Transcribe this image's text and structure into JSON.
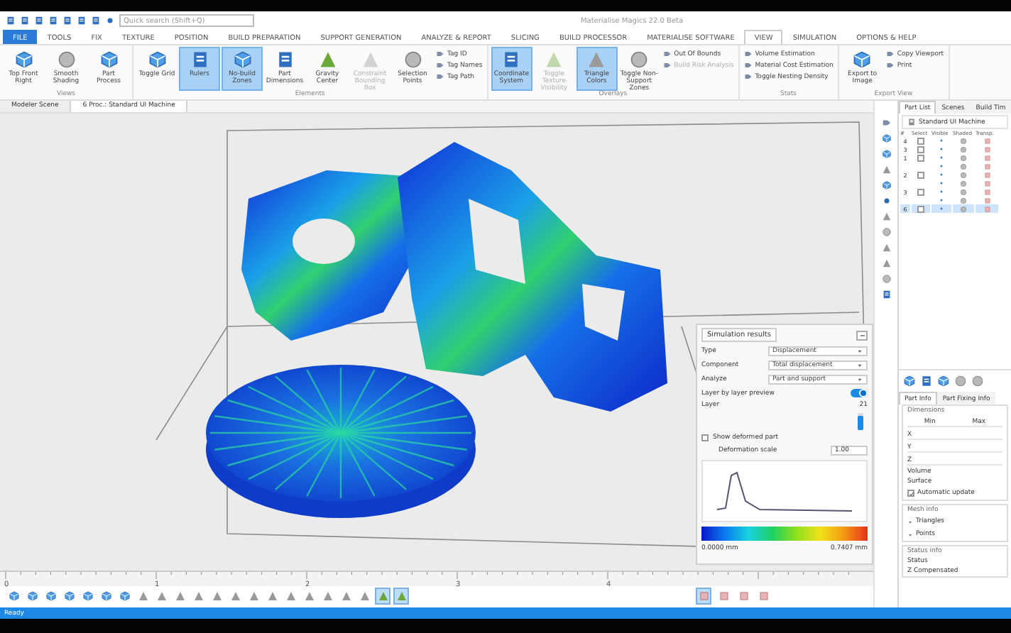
{
  "window": {
    "title": "Materialise Magics 22.0 Beta"
  },
  "quick_access": {
    "search": {
      "placeholder": "Quick search (Shift+Q)"
    }
  },
  "ribbon_tabs": [
    {
      "label": "FILE",
      "kind": "file",
      "selected": false
    },
    {
      "label": "TOOLS",
      "kind": "tab",
      "selected": false
    },
    {
      "label": "FIX",
      "kind": "tab",
      "selected": false
    },
    {
      "label": "TEXTURE",
      "kind": "tab",
      "selected": false
    },
    {
      "label": "POSITION",
      "kind": "tab",
      "selected": false
    },
    {
      "label": "BUILD PREPARATION",
      "kind": "tab",
      "selected": false
    },
    {
      "label": "SUPPORT GENERATION",
      "kind": "tab",
      "selected": false
    },
    {
      "label": "ANALYZE & REPORT",
      "kind": "tab",
      "selected": false
    },
    {
      "label": "SLICING",
      "kind": "tab",
      "selected": false
    },
    {
      "label": "BUILD PROCESSOR",
      "kind": "tab",
      "selected": false
    },
    {
      "label": "MATERIALISE SOFTWARE",
      "kind": "tab",
      "selected": false
    },
    {
      "label": "VIEW",
      "kind": "tab",
      "selected": true
    },
    {
      "label": "SIMULATION",
      "kind": "tab",
      "selected": false
    },
    {
      "label": "OPTIONS & HELP",
      "kind": "tab",
      "selected": false
    }
  ],
  "ribbon_groups": [
    {
      "title": "Views",
      "items": [
        {
          "kind": "large",
          "label": "Top Front Right",
          "selected": false,
          "disabled": false
        },
        {
          "kind": "large",
          "label": "Smooth Shading",
          "selected": false,
          "disabled": false
        },
        {
          "kind": "large",
          "label": "Part Process",
          "selected": false,
          "disabled": false
        }
      ]
    },
    {
      "title": "Elements",
      "items": [
        {
          "kind": "large",
          "label": "Toggle Grid",
          "selected": false,
          "disabled": false
        },
        {
          "kind": "large",
          "label": "Rulers",
          "selected": true,
          "disabled": false
        },
        {
          "kind": "large",
          "label": "No-build Zones",
          "selected": true,
          "disabled": false
        },
        {
          "kind": "large",
          "label": "Part Dimensions",
          "selected": false,
          "disabled": false
        },
        {
          "kind": "large",
          "label": "Gravity Center",
          "selected": false,
          "disabled": false
        },
        {
          "kind": "large",
          "label": "Constraint Bounding Box",
          "selected": false,
          "disabled": true
        },
        {
          "kind": "large",
          "label": "Selection Points",
          "selected": false,
          "disabled": false
        },
        {
          "kind": "stack",
          "entries": [
            {
              "label": "Tag ID",
              "disabled": false
            },
            {
              "label": "Tag Names",
              "disabled": false
            },
            {
              "label": "Tag Path",
              "disabled": false
            }
          ]
        }
      ]
    },
    {
      "title": "Overlays",
      "items": [
        {
          "kind": "large",
          "label": "Coordinate System",
          "selected": true,
          "disabled": false
        },
        {
          "kind": "large",
          "label": "Toggle Texture Visibility",
          "selected": false,
          "disabled": true
        },
        {
          "kind": "large",
          "label": "Triangle Colors",
          "selected": true,
          "disabled": false
        },
        {
          "kind": "large",
          "label": "Toggle Non-Support Zones",
          "selected": false,
          "disabled": false
        },
        {
          "kind": "stack",
          "entries": [
            {
              "label": "Out Of Bounds",
              "disabled": false
            },
            {
              "label": "Build Risk Analysis",
              "disabled": true
            }
          ]
        }
      ]
    },
    {
      "title": "Stats",
      "items": [
        {
          "kind": "stack",
          "entries": [
            {
              "label": "Volume Estimation",
              "disabled": false
            },
            {
              "label": "Material Cost Estimation",
              "disabled": false
            },
            {
              "label": "Toggle Nesting Density",
              "disabled": false
            }
          ]
        }
      ]
    },
    {
      "title": "Export View",
      "items": [
        {
          "kind": "large",
          "label": "Export to Image",
          "selected": false,
          "disabled": false
        },
        {
          "kind": "stack",
          "entries": [
            {
              "label": "Copy Viewport",
              "disabled": false
            },
            {
              "label": "Print",
              "disabled": false
            }
          ]
        }
      ]
    }
  ],
  "document_tabs": [
    {
      "label": "Modeler Scene",
      "selected": false
    },
    {
      "label": "6 Proc.: Standard UI Machine",
      "selected": true
    }
  ],
  "simulation_panel": {
    "title": "Simulation results",
    "fields": [
      {
        "label": "Type",
        "value": "Displacement"
      },
      {
        "label": "Component",
        "value": "Total displacement"
      },
      {
        "label": "Analyze",
        "value": "Part and support"
      }
    ],
    "layer_preview": {
      "label": "Layer by layer preview",
      "on": true
    },
    "layer": {
      "label": "Layer",
      "value": "21",
      "level": 0.85
    },
    "show_deformed": {
      "label": "Show deformed part",
      "checked": false
    },
    "deformation_scale": {
      "label": "Deformation scale",
      "value": "1.00"
    },
    "scale_min": "0.0000 mm",
    "scale_max": "0.7407 mm"
  },
  "ruler": {
    "labels": [
      "0",
      "1",
      "2",
      "3",
      "4"
    ]
  },
  "bottom_toolbar": [
    {
      "selected": false
    },
    {
      "selected": false
    },
    {
      "selected": false
    },
    {
      "selected": false
    },
    {
      "selected": false
    },
    {
      "selected": false
    },
    {
      "selected": false
    },
    {
      "selected": false
    },
    {
      "selected": false
    },
    {
      "selected": false
    },
    {
      "selected": false
    },
    {
      "selected": false
    },
    {
      "selected": false
    },
    {
      "selected": false
    },
    {
      "selected": false
    },
    {
      "selected": false
    },
    {
      "selected": false
    },
    {
      "selected": false
    },
    {
      "selected": false
    },
    {
      "selected": false
    },
    {
      "selected": true
    },
    {
      "selected": true
    }
  ],
  "view_buttons": [
    {
      "selected": true
    },
    {
      "selected": false
    },
    {
      "selected": false
    },
    {
      "selected": false
    }
  ],
  "part_list": {
    "tabs": [
      {
        "label": "Part List",
        "selected": true
      },
      {
        "label": "Scenes",
        "selected": false
      },
      {
        "label": "Build Tim",
        "selected": false
      }
    ],
    "machine": "Standard UI Machine",
    "columns": [
      "#",
      "Select",
      "Visible",
      "Shaded",
      "Transp."
    ],
    "rows": [
      {
        "kind": "part",
        "number": "4",
        "checked": false,
        "selected": false
      },
      {
        "kind": "part",
        "number": "3",
        "checked": false,
        "selected": false
      },
      {
        "kind": "part",
        "number": "1",
        "checked": false,
        "selected": false
      },
      {
        "kind": "support",
        "selected": false
      },
      {
        "kind": "part",
        "number": "2",
        "checked": false,
        "selected": false
      },
      {
        "kind": "support",
        "selected": false
      },
      {
        "kind": "part",
        "number": "3",
        "checked": false,
        "selected": false
      },
      {
        "kind": "support",
        "selected": false
      },
      {
        "kind": "part",
        "number": "6",
        "checked": false,
        "selected": true
      }
    ]
  },
  "part_info": {
    "tabs": [
      {
        "label": "Part Info",
        "selected": true
      },
      {
        "label": "Part Fixing Info",
        "selected": false
      }
    ],
    "dimensions": {
      "title": "Dimensions",
      "columns": [
        "Min",
        "Max"
      ],
      "axes": [
        "X",
        "Y",
        "Z"
      ],
      "volume": "Volume",
      "surface": "Surface",
      "automatic_update": {
        "label": "Automatic update",
        "checked": true
      }
    },
    "mesh_info": {
      "title": "Mesh info",
      "items": [
        "Triangles",
        "Points"
      ]
    },
    "status_info": {
      "title": "Status info",
      "items": [
        "Status",
        "Z Compensated"
      ]
    }
  },
  "status_bar": {
    "text": "Ready"
  }
}
